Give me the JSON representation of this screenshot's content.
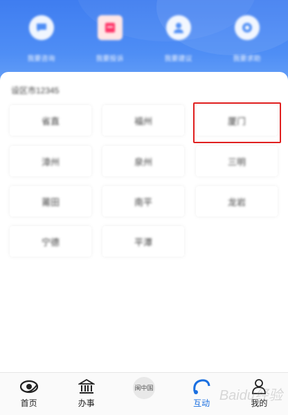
{
  "quick_actions": [
    {
      "label": "我要咨询",
      "icon": "chat-icon"
    },
    {
      "label": "我要投诉",
      "icon": "complaint-icon"
    },
    {
      "label": "我要建议",
      "icon": "suggestion-icon"
    },
    {
      "label": "我要求助",
      "icon": "help-icon"
    }
  ],
  "section_title": "设区市12345",
  "cities": [
    "福州",
    "厦门",
    "漳州",
    "泉州",
    "三明",
    "莆田",
    "南平",
    "龙岩",
    "宁德",
    "平潭"
  ],
  "city_cells": [
    {
      "label": "省直"
    },
    {
      "label": "福州"
    },
    {
      "label": "厦门"
    },
    {
      "label": "漳州"
    },
    {
      "label": "泉州"
    },
    {
      "label": "三明"
    },
    {
      "label": "莆田"
    },
    {
      "label": "南平"
    },
    {
      "label": "龙岩"
    },
    {
      "label": "宁德"
    },
    {
      "label": "平潭"
    }
  ],
  "highlighted_city": "厦门",
  "bottom_nav": [
    {
      "label": "首页",
      "icon": "home-eye-icon",
      "active": false
    },
    {
      "label": "办事",
      "icon": "building-icon",
      "active": false
    },
    {
      "label": "中国",
      "icon": "seal-icon",
      "active": false
    },
    {
      "label": "互动",
      "icon": "12345-icon",
      "active": true
    },
    {
      "label": "我的",
      "icon": "user-icon",
      "active": false
    }
  ],
  "seal_text": "闽中国",
  "nav_badge": "12345",
  "watermark": "Baidu经验",
  "colors": {
    "header_blue": "#4f8ef5",
    "highlight_red": "#e02020",
    "active_blue": "#1a6fe0"
  }
}
